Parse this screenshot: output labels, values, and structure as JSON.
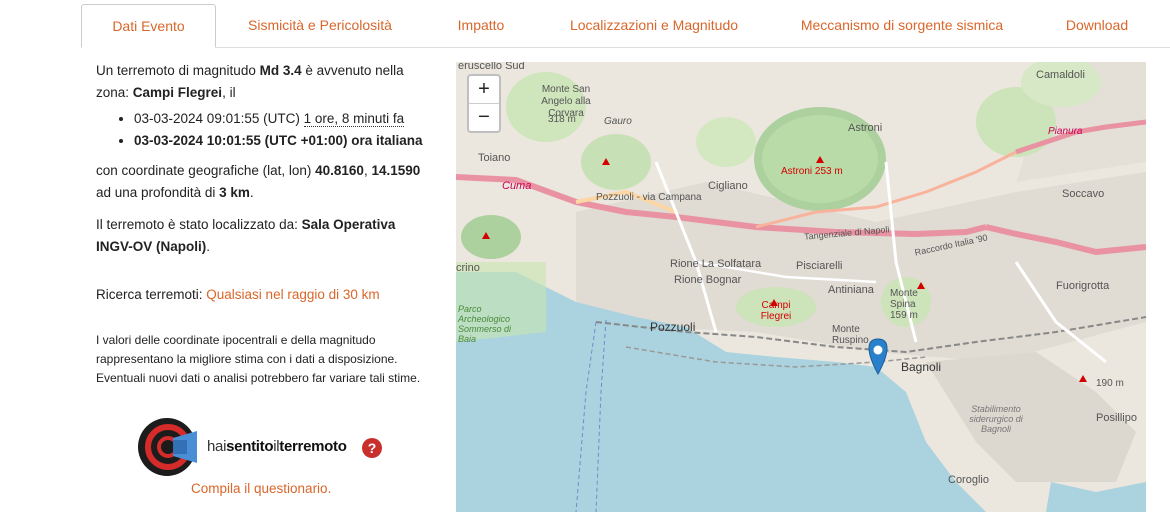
{
  "tabs": [
    {
      "label": "Dati Evento",
      "active": true
    },
    {
      "label": "Sismicità e Pericolosità"
    },
    {
      "label": "Impatto"
    },
    {
      "label": "Localizzazioni e Magnitudo"
    },
    {
      "label": "Meccanismo di sorgente sismica"
    },
    {
      "label": "Download"
    }
  ],
  "event": {
    "intro_prefix": "Un terremoto di magnitudo ",
    "magnitude": "Md 3.4",
    "intro_mid": " è avvenuto nella zona: ",
    "zone": "Campi Flegrei",
    "intro_suffix": ", il",
    "utc_time": "03-03-2024 09:01:55 (UTC)",
    "ago": "1 ore, 8 minuti fa",
    "local_time": "03-03-2024 10:01:55 (UTC +01:00) ora italiana",
    "coords_prefix": "con coordinate geografiche (lat, lon) ",
    "lat": "40.8160",
    "coords_sep": ", ",
    "lon": "14.1590",
    "depth_prefix": "ad una profondità di ",
    "depth": "3 km",
    "depth_suffix": ".",
    "located_prefix": "Il terremoto è stato localizzato da: ",
    "located_by": "Sala Operativa INGV-OV (Napoli)",
    "located_suffix": ".",
    "search_label": "Ricerca terremoti: ",
    "search_link": "Qualsiasi nel raggio di 30 km",
    "note": "I valori delle coordinate ipocentrali e della magnitudo rappresentano la migliore stima con i dati a disposizione. Eventuali nuovi dati o analisi potrebbero far variare tali stime.",
    "logo_text_a": "hai",
    "logo_text_b": "sentito",
    "logo_text_c": "il",
    "logo_text_d": "terremoto",
    "compile_link": "Compila il questionario."
  },
  "map": {
    "zoom_in": "+",
    "zoom_out": "−",
    "labels": [
      "eruscello Sud",
      "Monte San Angelo alla Corvara",
      "318 m",
      "Gauro",
      "Toiano",
      "Cuma",
      "Astroni",
      "Astroni 253 m",
      "Cigliano",
      "Pozzuoli - via Campana",
      "Soccavo",
      "Camaldoli",
      "Pianura",
      "Tangenziale di Napoli",
      "Raccordo Italia '90",
      "Fuorigrotta",
      "Rione La Solfatara",
      "Pisciarelli",
      "Rione Bognar",
      "Campi Flegrei",
      "Antiniana",
      "Monte Spina 159 m",
      "Pozzuoli",
      "Monte Ruspino",
      "Bagnoli",
      "Parco Archeologico Sommerso di Baia",
      "Stabilimento siderurgico di Bagnoli",
      "Posillipo",
      "Coroglio",
      "190 m",
      "crino"
    ]
  },
  "colors": {
    "accent": "#d9662a",
    "sea": "#aad3df",
    "land": "#e8e3da",
    "park": "#c8e6b0",
    "motorway": "#e892a2",
    "marker": "#2a81cb"
  }
}
